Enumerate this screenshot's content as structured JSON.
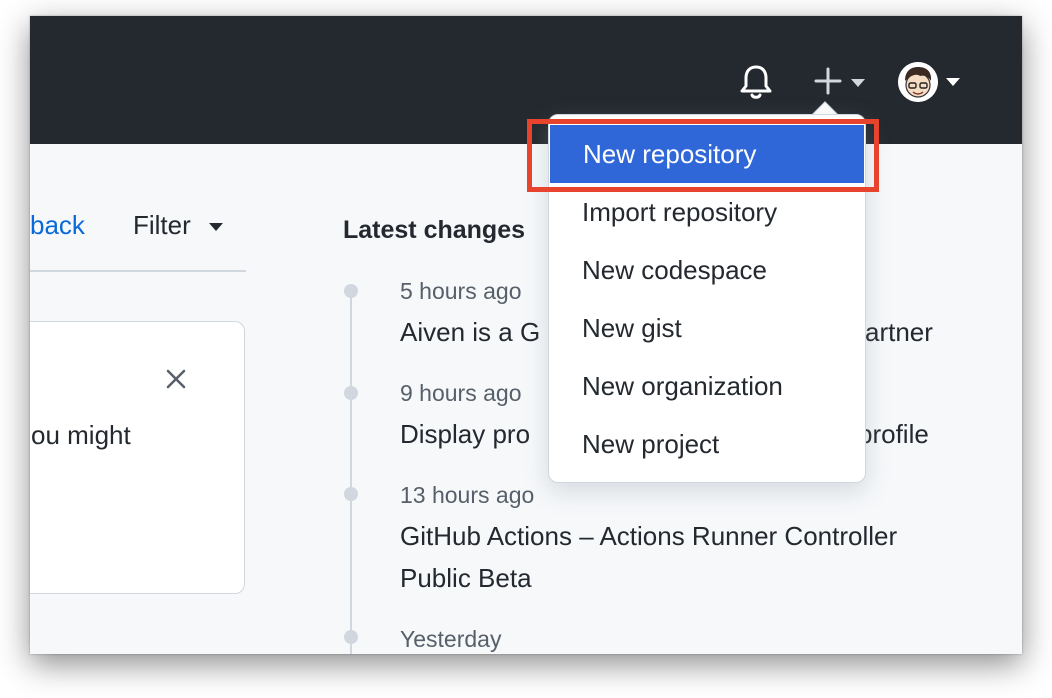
{
  "header": {
    "notifications_icon": "bell-icon",
    "create_icon": "plus-icon",
    "avatar_icon": "avatar"
  },
  "left": {
    "feedback_link": "back",
    "filter_label": "Filter",
    "card_text": "ou might"
  },
  "latest_changes": {
    "title": "Latest changes",
    "items": [
      {
        "time": "5 hours ago",
        "lines": [
          "Aiven is a G",
          "artner"
        ]
      },
      {
        "time": "9 hours ago",
        "lines": [
          "Display pro",
          "profile"
        ]
      },
      {
        "time": "13 hours ago",
        "lines": [
          "GitHub Actions – Actions Runner Controller",
          "Public Beta"
        ]
      },
      {
        "time": "Yesterday",
        "lines": []
      }
    ]
  },
  "create_menu": {
    "items": [
      {
        "label": "New repository",
        "active": true
      },
      {
        "label": "Import repository"
      },
      {
        "label": "New codespace"
      },
      {
        "label": "New gist"
      },
      {
        "label": "New organization"
      },
      {
        "label": "New project"
      }
    ]
  },
  "colors": {
    "topbar": "#24292f",
    "link": "#0969da",
    "menu_active": "#2f67d9",
    "highlight": "#e8432c"
  }
}
